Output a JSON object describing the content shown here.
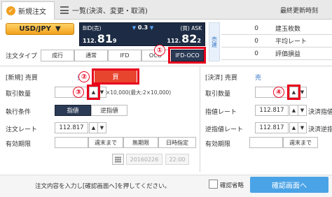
{
  "tabs": {
    "new_order": "新規注文",
    "list": "一覧(決済、変更・取消)"
  },
  "last_update_label": "最終更新時刻",
  "pair": {
    "label": "USD/JPY",
    "chevron": "▼"
  },
  "quote": {
    "bid_label": "BID(売)",
    "ask_label": "(買) ASK",
    "spread": "0.3",
    "bid_int": "112.",
    "bid_dec": "81",
    "bid_last": "9",
    "ask_int": "112.",
    "ask_dec": "82",
    "ask_last": "2"
  },
  "summary": {
    "side_label": "売建",
    "rows": [
      {
        "value": "0",
        "label": "建玉枚数"
      },
      {
        "value": "0",
        "label": "平均レート"
      },
      {
        "value": "0",
        "label": "評価損益"
      }
    ]
  },
  "order_type": {
    "label": "注文タイプ",
    "options": [
      "成行",
      "通常",
      "IFD",
      "OCO",
      "IFD-OCO"
    ],
    "selected": "IFD-OCO"
  },
  "left_form": {
    "section": "[新規] 売買",
    "sell": "売",
    "buy": "買",
    "qty_label": "取引数量",
    "qty_note": "×10,000(最大:2×10,000)",
    "exec_label": "執行条件",
    "exec_opts": [
      "指値",
      "逆指値"
    ],
    "rate_label": "注文レート",
    "rate_value": "112.817",
    "expiry_label": "有効期限",
    "expiry_opts": [
      "当日限り",
      "週末まで",
      "無期限",
      "日時指定"
    ],
    "date_value": "20160226",
    "time_value": "22:00"
  },
  "right_form": {
    "section": "[決済] 売買",
    "side": "売",
    "qty_label": "取引数量",
    "limit_label": "指値レート",
    "limit_value": "112.817",
    "limit_suffix": "決済指値",
    "stop_label": "逆指値レート",
    "stop_value": "112.817",
    "stop_suffix": "決済逆指",
    "expiry_label": "有効期限",
    "expiry_opts": [
      "当日限り",
      "週末まで"
    ]
  },
  "footer": {
    "message": "注文内容を入力し[確認画面へ]を押してください。",
    "skip_confirm": "確認省略",
    "confirm": "確認画面へ"
  },
  "markers": [
    "①",
    "②",
    "③",
    "④"
  ],
  "icons": {
    "up": "▲",
    "down": "▼"
  }
}
